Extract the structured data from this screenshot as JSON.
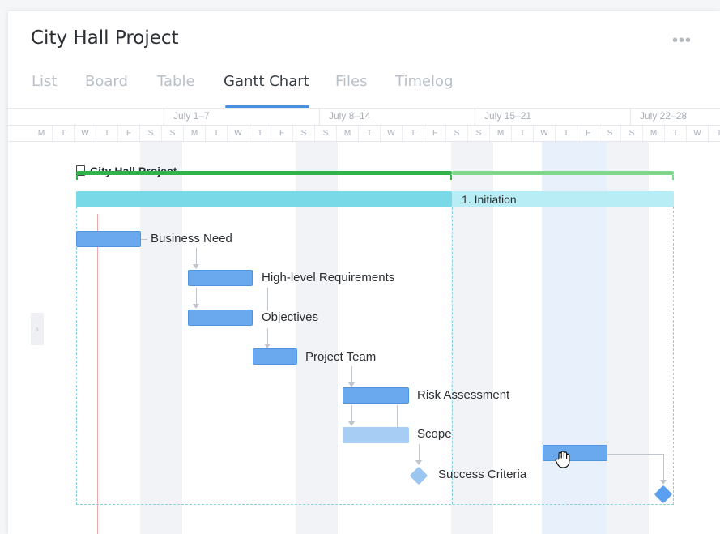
{
  "header": {
    "title": "City Hall Project",
    "more_icon": "more-horizontal-icon",
    "more_label": "•••"
  },
  "tabs": [
    {
      "label": "List",
      "active": false
    },
    {
      "label": "Board",
      "active": false
    },
    {
      "label": "Table",
      "active": false
    },
    {
      "label": "Gantt Chart",
      "active": true
    },
    {
      "label": "Files",
      "active": false
    },
    {
      "label": "Timelog",
      "active": false
    }
  ],
  "timeline": {
    "weeks": [
      "July 1–7",
      "July 8–14",
      "July 15–21",
      "July 22–28"
    ],
    "days": [
      "M",
      "T",
      "W",
      "T",
      "F",
      "S",
      "S",
      "M",
      "T",
      "W",
      "T",
      "F",
      "S",
      "S",
      "M",
      "T",
      "W",
      "T",
      "F",
      "S",
      "S",
      "M",
      "T",
      "W",
      "T",
      "F",
      "S",
      "S",
      "M",
      "T",
      "W",
      "T",
      "F",
      "S"
    ]
  },
  "project": {
    "label": "City Hall Project",
    "icon": "clipboard-icon"
  },
  "group": {
    "label": "1. Initiation"
  },
  "tasks": [
    {
      "label": "Business Need"
    },
    {
      "label": "High-level Requirements"
    },
    {
      "label": "Objectives"
    },
    {
      "label": "Project Team"
    },
    {
      "label": "Risk Assessment"
    },
    {
      "label": "Scope"
    }
  ],
  "milestones": [
    {
      "label": "Success Criteria"
    }
  ],
  "side_handle": {
    "glyph": "›",
    "icon": "chevron-right-icon"
  },
  "colors": {
    "accent": "#4a90e2",
    "task": "#6aa9ee",
    "project": "#2fb34a",
    "group": "#79d9e6",
    "today": "#f0a9a9"
  }
}
